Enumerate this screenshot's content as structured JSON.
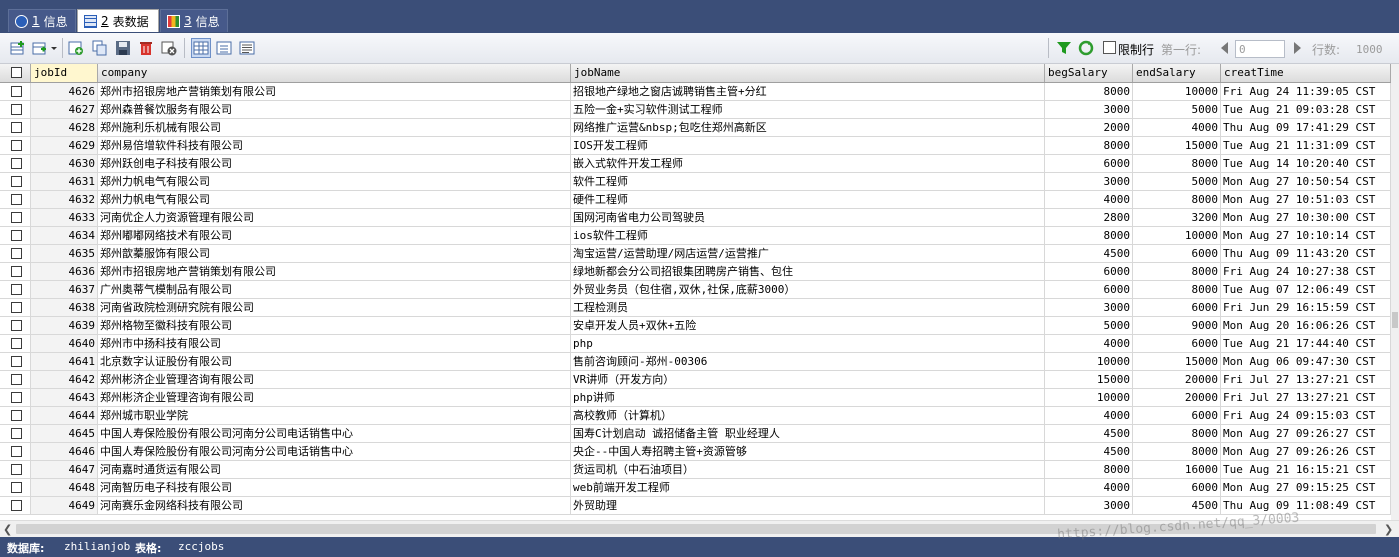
{
  "tabs": [
    {
      "num": "1",
      "label": "信息",
      "icon": "info-icon",
      "active": false
    },
    {
      "num": "2",
      "label": "表数据",
      "icon": "table-grid-icon",
      "active": true
    },
    {
      "num": "3",
      "label": "信息",
      "icon": "chart-info-icon",
      "active": false
    }
  ],
  "toolbar": {
    "limit_label": "限制行",
    "first_row_label": "第一行:",
    "first_row_value": "0",
    "rows_label": "行数:",
    "rows_value": "1000",
    "limit_checked": false
  },
  "columns": [
    "jobId",
    "company",
    "jobName",
    "begSalary",
    "endSalary",
    "creatTime"
  ],
  "rows": [
    {
      "jobId": "4626",
      "company": "郑州市招银房地产营销策划有限公司",
      "jobName": "招银地产绿地之窗店诚聘销售主管+分红",
      "begSalary": "8000",
      "endSalary": "10000",
      "creatTime": "Fri Aug 24 11:39:05 CST"
    },
    {
      "jobId": "4627",
      "company": "郑州森普餐饮服务有限公司",
      "jobName": "五险一金+实习软件测试工程师",
      "begSalary": "3000",
      "endSalary": "5000",
      "creatTime": "Tue Aug 21 09:03:28 CST"
    },
    {
      "jobId": "4628",
      "company": "郑州施利乐机械有限公司",
      "jobName": "网络推广运营&nbsp;包吃住郑州高新区",
      "begSalary": "2000",
      "endSalary": "4000",
      "creatTime": "Thu Aug 09 17:41:29 CST"
    },
    {
      "jobId": "4629",
      "company": "郑州易倍增软件科技有限公司",
      "jobName": "IOS开发工程师",
      "begSalary": "8000",
      "endSalary": "15000",
      "creatTime": "Tue Aug 21 11:31:09 CST"
    },
    {
      "jobId": "4630",
      "company": "郑州跃创电子科技有限公司",
      "jobName": "嵌入式软件开发工程师",
      "begSalary": "6000",
      "endSalary": "8000",
      "creatTime": "Tue Aug 14 10:20:40 CST"
    },
    {
      "jobId": "4631",
      "company": "郑州力帆电气有限公司",
      "jobName": "软件工程师",
      "begSalary": "3000",
      "endSalary": "5000",
      "creatTime": "Mon Aug 27 10:50:54 CST"
    },
    {
      "jobId": "4632",
      "company": "郑州力帆电气有限公司",
      "jobName": "硬件工程师",
      "begSalary": "4000",
      "endSalary": "8000",
      "creatTime": "Mon Aug 27 10:51:03 CST"
    },
    {
      "jobId": "4633",
      "company": "河南优企人力资源管理有限公司",
      "jobName": "国网河南省电力公司驾驶员",
      "begSalary": "2800",
      "endSalary": "3200",
      "creatTime": "Mon Aug 27 10:30:00 CST"
    },
    {
      "jobId": "4634",
      "company": "郑州嘟嘟网络技术有限公司",
      "jobName": "ios软件工程师",
      "begSalary": "8000",
      "endSalary": "10000",
      "creatTime": "Mon Aug 27 10:10:14 CST"
    },
    {
      "jobId": "4635",
      "company": "郑州歆蓁服饰有限公司",
      "jobName": "淘宝运营/运营助理/网店运营/运营推广",
      "begSalary": "4500",
      "endSalary": "6000",
      "creatTime": "Thu Aug 09 11:43:20 CST"
    },
    {
      "jobId": "4636",
      "company": "郑州市招银房地产营销策划有限公司",
      "jobName": "绿地新都会分公司招银集团聘房产销售、包住",
      "begSalary": "6000",
      "endSalary": "8000",
      "creatTime": "Fri Aug 24 10:27:38 CST"
    },
    {
      "jobId": "4637",
      "company": "广州奥蒂气模制品有限公司",
      "jobName": "外贸业务员（包住宿,双休,社保,底薪3000）",
      "begSalary": "6000",
      "endSalary": "8000",
      "creatTime": "Tue Aug 07 12:06:49 CST"
    },
    {
      "jobId": "4638",
      "company": "河南省政院检测研究院有限公司",
      "jobName": "工程检测员",
      "begSalary": "3000",
      "endSalary": "6000",
      "creatTime": "Fri Jun 29 16:15:59 CST"
    },
    {
      "jobId": "4639",
      "company": "郑州格物至徽科技有限公司",
      "jobName": "安卓开发人员+双休+五险",
      "begSalary": "5000",
      "endSalary": "9000",
      "creatTime": "Mon Aug 20 16:06:26 CST"
    },
    {
      "jobId": "4640",
      "company": "郑州市中扬科技有限公司",
      "jobName": "php",
      "begSalary": "4000",
      "endSalary": "6000",
      "creatTime": "Tue Aug 21 17:44:40 CST"
    },
    {
      "jobId": "4641",
      "company": "北京数字认证股份有限公司",
      "jobName": "售前咨询顾问-郑州-00306",
      "begSalary": "10000",
      "endSalary": "15000",
      "creatTime": "Mon Aug 06 09:47:30 CST"
    },
    {
      "jobId": "4642",
      "company": "郑州彬济企业管理咨询有限公司",
      "jobName": "VR讲师（开发方向）",
      "begSalary": "15000",
      "endSalary": "20000",
      "creatTime": "Fri Jul 27 13:27:21 CST"
    },
    {
      "jobId": "4643",
      "company": "郑州彬济企业管理咨询有限公司",
      "jobName": "php讲师",
      "begSalary": "10000",
      "endSalary": "20000",
      "creatTime": "Fri Jul 27 13:27:21 CST"
    },
    {
      "jobId": "4644",
      "company": "郑州城市职业学院",
      "jobName": "高校教师（计算机）",
      "begSalary": "4000",
      "endSalary": "6000",
      "creatTime": "Fri Aug 24 09:15:03 CST"
    },
    {
      "jobId": "4645",
      "company": "中国人寿保险股份有限公司河南分公司电话销售中心",
      "jobName": "国寿C计划启动 诚招储备主管 职业经理人",
      "begSalary": "4500",
      "endSalary": "8000",
      "creatTime": "Mon Aug 27 09:26:27 CST"
    },
    {
      "jobId": "4646",
      "company": "中国人寿保险股份有限公司河南分公司电话销售中心",
      "jobName": "央企--中国人寿招聘主管+资源管够",
      "begSalary": "4500",
      "endSalary": "8000",
      "creatTime": "Mon Aug 27 09:26:26 CST"
    },
    {
      "jobId": "4647",
      "company": "河南嘉时通货运有限公司",
      "jobName": "货运司机（中石油项目）",
      "begSalary": "8000",
      "endSalary": "16000",
      "creatTime": "Tue Aug 21 16:15:21 CST"
    },
    {
      "jobId": "4648",
      "company": "河南智历电子科技有限公司",
      "jobName": "web前端开发工程师",
      "begSalary": "4000",
      "endSalary": "6000",
      "creatTime": "Mon Aug 27 09:15:25 CST"
    },
    {
      "jobId": "4649",
      "company": "河南赛乐金网络科技有限公司",
      "jobName": "外贸助理",
      "begSalary": "3000",
      "endSalary": "4500",
      "creatTime": "Thu Aug 09 11:08:49 CST"
    }
  ],
  "status": {
    "db_label": "数据库:",
    "db_value": "zhilianjob",
    "table_label": "表格:",
    "table_value": "zccjobs"
  },
  "watermark": "https://blog.csdn.net/qq_3/0003",
  "colors": {
    "navy": "#3b4e78",
    "header_highlight": "#fff7cf"
  }
}
